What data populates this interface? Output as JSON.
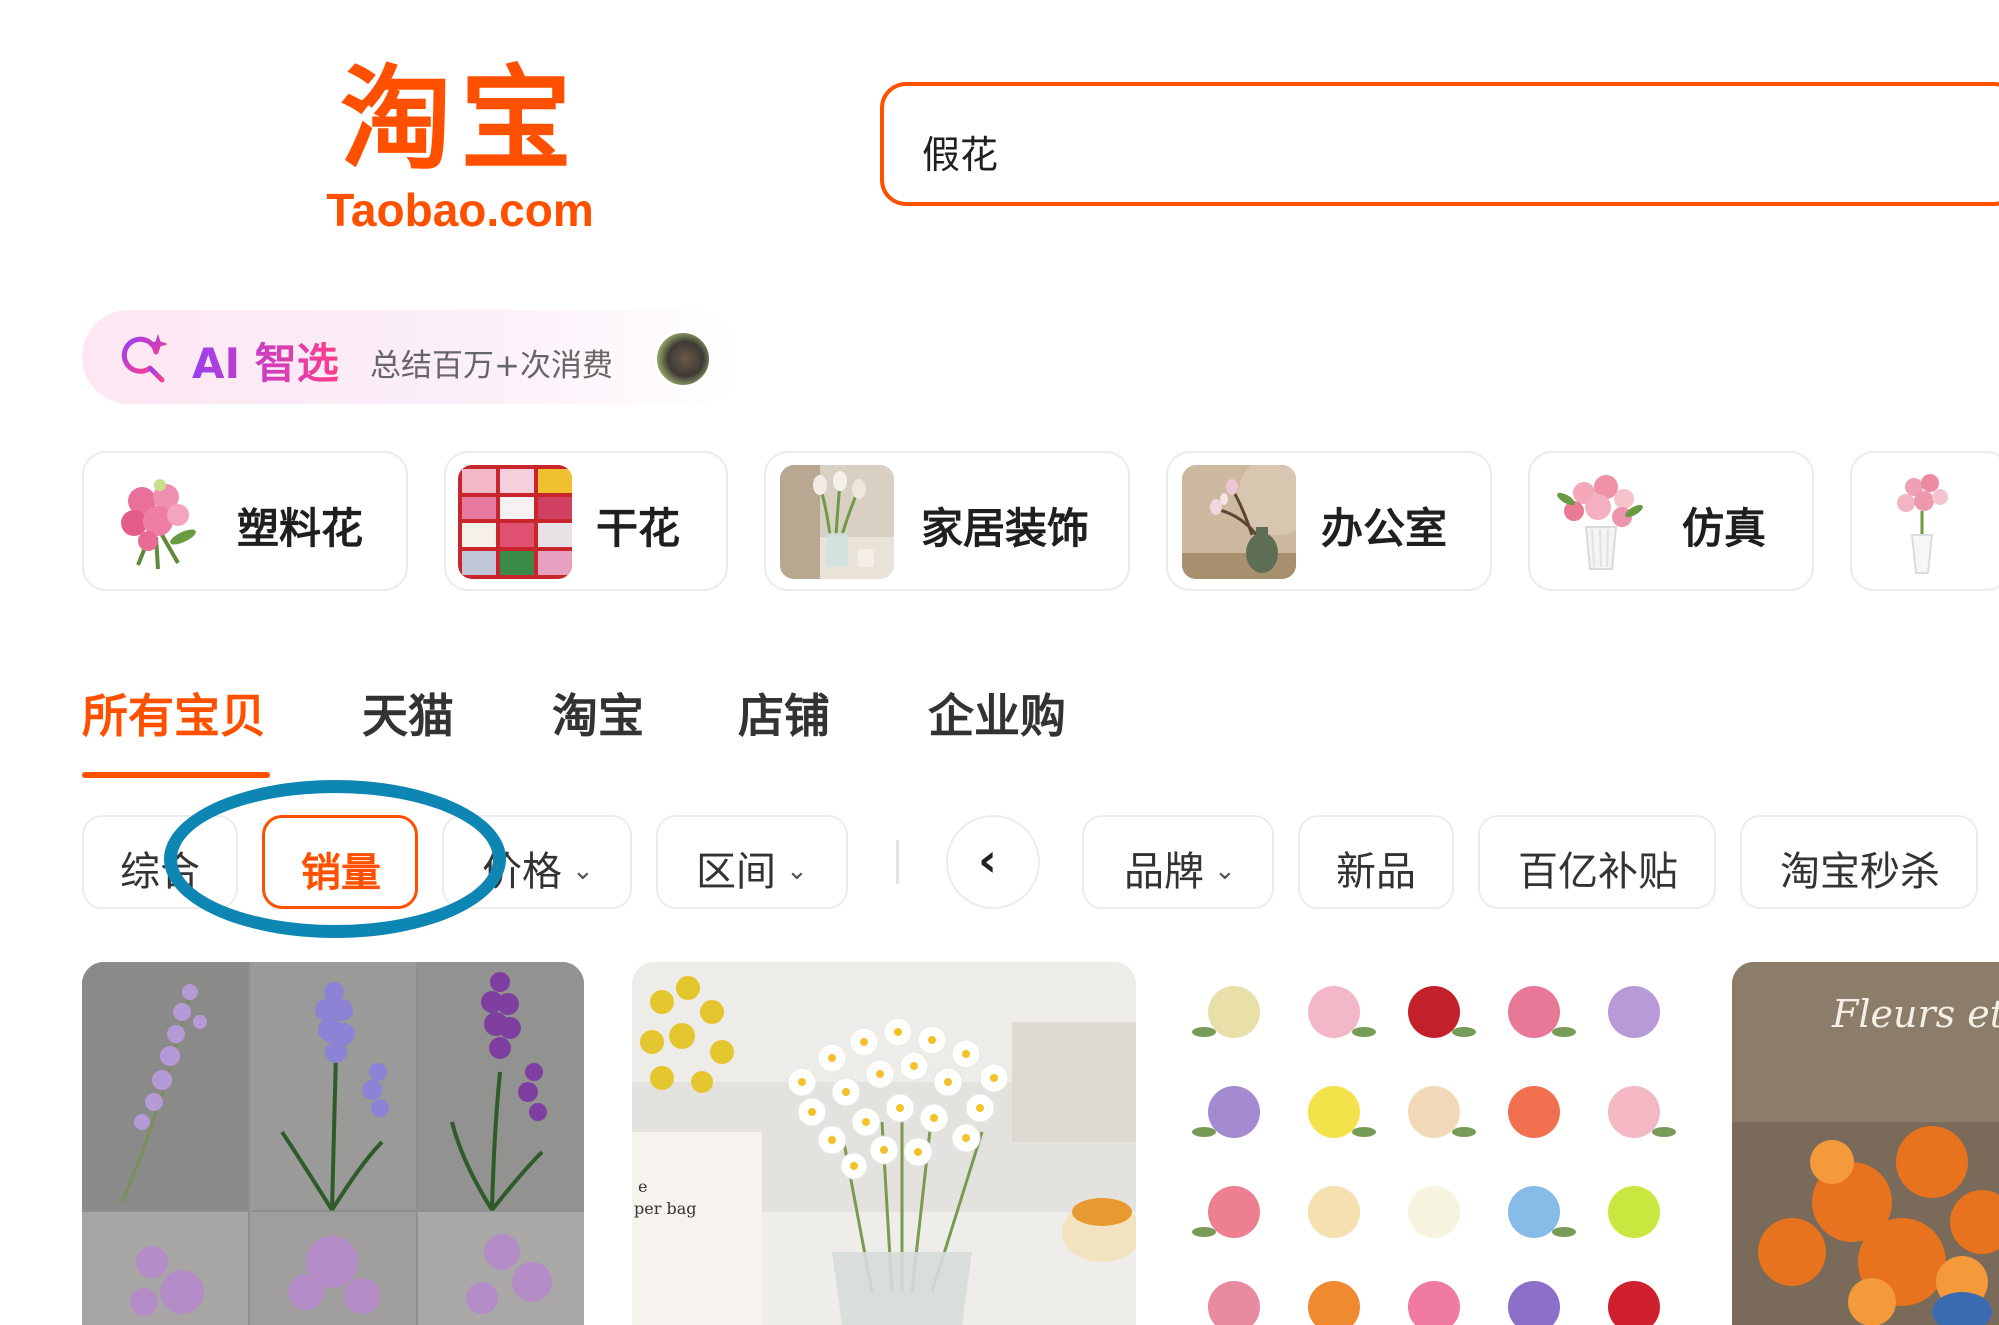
{
  "logo": {
    "main": "淘宝",
    "sub": "Taobao.com"
  },
  "search": {
    "value": "假花"
  },
  "ai": {
    "label": "AI 智选",
    "desc": "总结百万+次消费"
  },
  "categories": [
    {
      "label": "塑料花",
      "icon": "pink-bouquet-thumbnail"
    },
    {
      "label": "干花",
      "icon": "flower-grid-thumbnail"
    },
    {
      "label": "家居装饰",
      "icon": "tulip-vase-thumbnail"
    },
    {
      "label": "办公室",
      "icon": "magnolia-vase-thumbnail"
    },
    {
      "label": "仿真",
      "icon": "rose-vase-thumbnail"
    },
    {
      "label": "",
      "icon": "pink-flower-vase-thumbnail"
    }
  ],
  "tabs": [
    "所有宝贝",
    "天猫",
    "淘宝",
    "店铺",
    "企业购"
  ],
  "active_tab": "所有宝贝",
  "filters": {
    "composite": "综合",
    "sales": "销量",
    "price": "价格",
    "range": "区间",
    "brand": "品牌",
    "new": "新品",
    "subsidy": "百亿补贴",
    "flash": "淘宝秒杀",
    "active": "销量"
  },
  "products": [
    {
      "image": "purple-hyacinth-grid"
    },
    {
      "image": "white-daisy-vase"
    },
    {
      "image": "rose-bouquet-color-grid",
      "overlay_text": ""
    },
    {
      "image": "orange-flower-arrangement",
      "overlay_text": "Fleurs et d'"
    }
  ],
  "colors": {
    "brand": "#ff5000",
    "annotation": "#0e86b4"
  }
}
